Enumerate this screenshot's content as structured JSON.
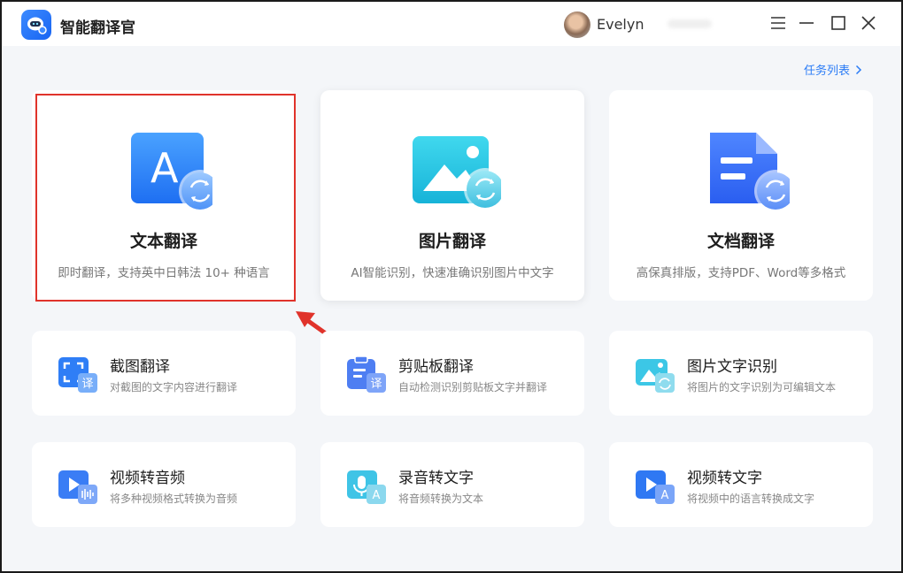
{
  "app": {
    "title": "智能翻译官"
  },
  "user": {
    "name": "Evelyn"
  },
  "header": {
    "task_list": "任务列表"
  },
  "icons": {
    "menu": "menu-icon",
    "minimize": "minimize-icon",
    "maximize": "maximize-icon",
    "close": "close-icon",
    "chevron": "chevron-right-icon"
  },
  "colors": {
    "accent": "#2b7cf6",
    "highlight": "#e0332b"
  },
  "features_main": [
    {
      "title": "文本翻译",
      "desc": "即时翻译，支持英中日韩法 10+ 种语言"
    },
    {
      "title": "图片翻译",
      "desc": "AI智能识别，快速准确识别图片中文字"
    },
    {
      "title": "文档翻译",
      "desc": "高保真排版，支持PDF、Word等多格式"
    }
  ],
  "features_small": [
    {
      "title": "截图翻译",
      "desc": "对截图的文字内容进行翻译",
      "badge": "译"
    },
    {
      "title": "剪贴板翻译",
      "desc": "自动检测识别剪贴板文字并翻译",
      "badge": "译"
    },
    {
      "title": "图片文字识别",
      "desc": "将图片的文字识别为可编辑文本"
    },
    {
      "title": "视频转音频",
      "desc": "将多种视频格式转换为音频"
    },
    {
      "title": "录音转文字",
      "desc": "将音频转换为文本",
      "badge": "A"
    },
    {
      "title": "视频转文字",
      "desc": "将视频中的语言转换成文字",
      "badge": "A"
    }
  ]
}
